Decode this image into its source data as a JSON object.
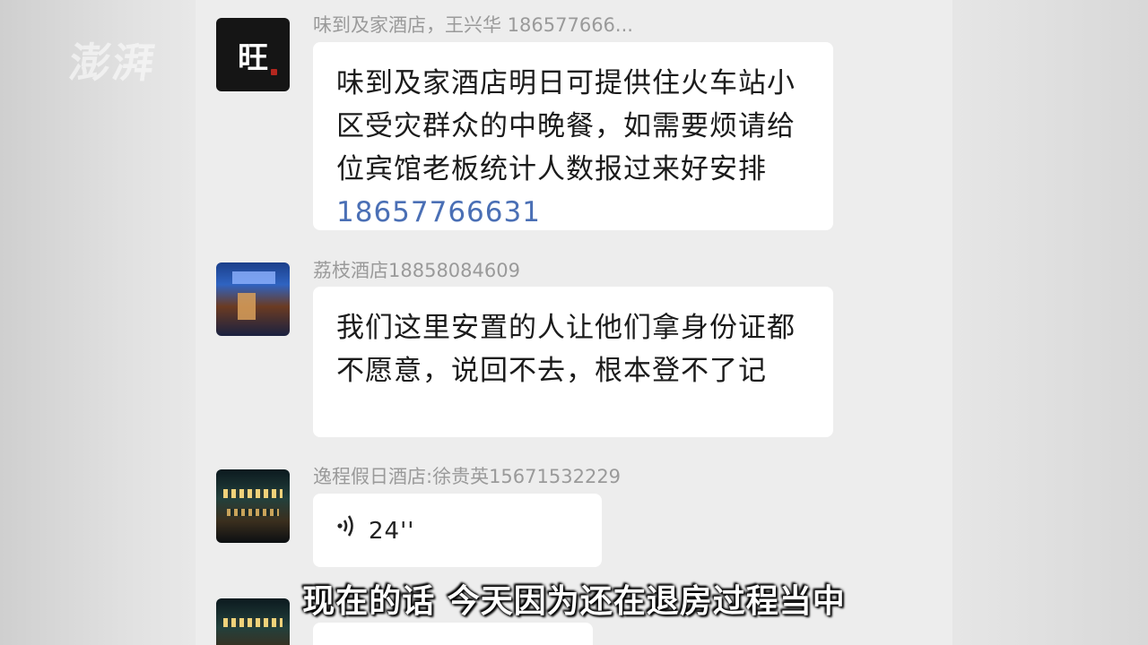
{
  "watermark": "澎湃",
  "messages": [
    {
      "sender": "味到及家酒店，王兴华 186577666...",
      "avatar_text": "旺",
      "text": "味到及家酒店明日可提供住火车站小区受灾群众的中晚餐，如需要烦请给位宾馆老板统计人数报过来好安排",
      "phone": "18657766631"
    },
    {
      "sender": "荔枝酒店18858084609",
      "text": "我们这里安置的人让他们拿身份证都不愿意，说回不去，根本登不了记"
    },
    {
      "sender": "逸程假日酒店:徐贵英15671532229",
      "voice_icon": "voice-wave-icon",
      "voice_duration": "24''"
    }
  ],
  "subtitle": "现在的话 今天因为还在退房过程当中"
}
